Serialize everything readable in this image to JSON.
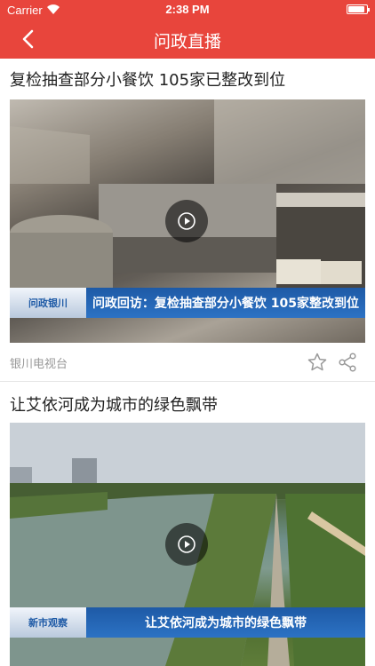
{
  "status": {
    "carrier": "Carrier",
    "time": "2:38 PM",
    "battery_level": 0.9
  },
  "nav": {
    "title": "问政直播"
  },
  "posts": [
    {
      "title": "复检抽查部分小餐饮 105家已整改到位",
      "caption": "问政回访：复检抽查部分小餐饮  105家整改到位",
      "logo_text": "问政银川",
      "source": "银川电视台"
    },
    {
      "title": "让艾依河成为城市的绿色飘带",
      "caption": "让艾依河成为城市的绿色飘带",
      "logo_text": "新市观察",
      "source": ""
    }
  ],
  "colors": {
    "brand": "#e8453c",
    "caption_blue": "#1e5aa6"
  }
}
